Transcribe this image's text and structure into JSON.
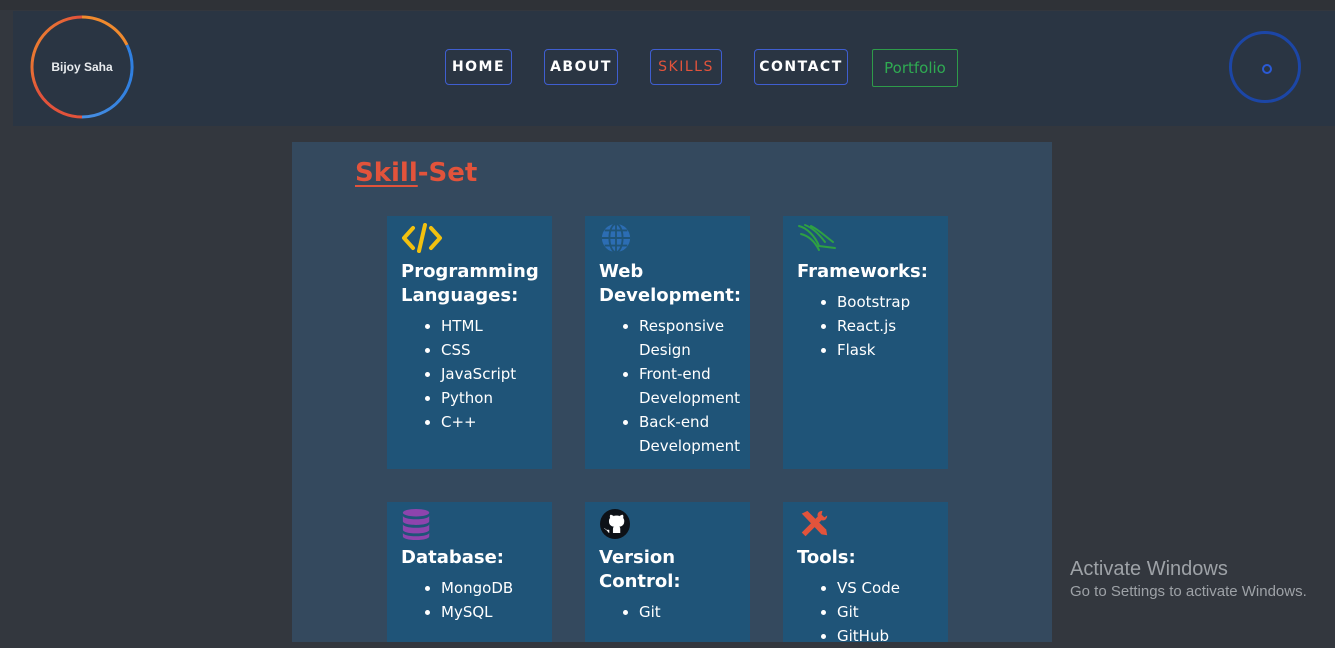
{
  "brand": {
    "name": "Bijoy Saha"
  },
  "nav": {
    "home": "HOME",
    "about": "ABOUT",
    "skills": "SKILLS",
    "contact": "CONTACT",
    "portfolio": "Portfolio"
  },
  "section": {
    "title_part1": "Skill",
    "title_part2": "-Set"
  },
  "skills": [
    {
      "title": "Programming Languages:",
      "icon": "code-icon",
      "items": [
        "HTML",
        "CSS",
        "JavaScript",
        "Python",
        "C++"
      ]
    },
    {
      "title": "Web Development:",
      "icon": "globe-icon",
      "items": [
        "Responsive Design",
        "Front-end Development",
        "Back-end Development"
      ]
    },
    {
      "title": "Frameworks:",
      "icon": "flask-framework-icon",
      "items": [
        "Bootstrap",
        "React.js",
        "Flask"
      ]
    },
    {
      "title": "Database:",
      "icon": "database-icon",
      "items": [
        "MongoDB",
        "MySQL"
      ]
    },
    {
      "title": "Version Control:",
      "icon": "github-icon",
      "items": [
        "Git"
      ]
    },
    {
      "title": "Tools:",
      "icon": "tools-icon",
      "items": [
        "VS Code",
        "Git",
        "GitHub"
      ]
    }
  ],
  "watermark": {
    "line1": "Activate Windows",
    "line2": "Go to Settings to activate Windows."
  },
  "colors": {
    "accent": "#e2533b",
    "nav_border": "#3f5ed0",
    "portfolio": "#2fab52",
    "card_bg": "#1f5478",
    "panel_bg": "#34495e"
  }
}
